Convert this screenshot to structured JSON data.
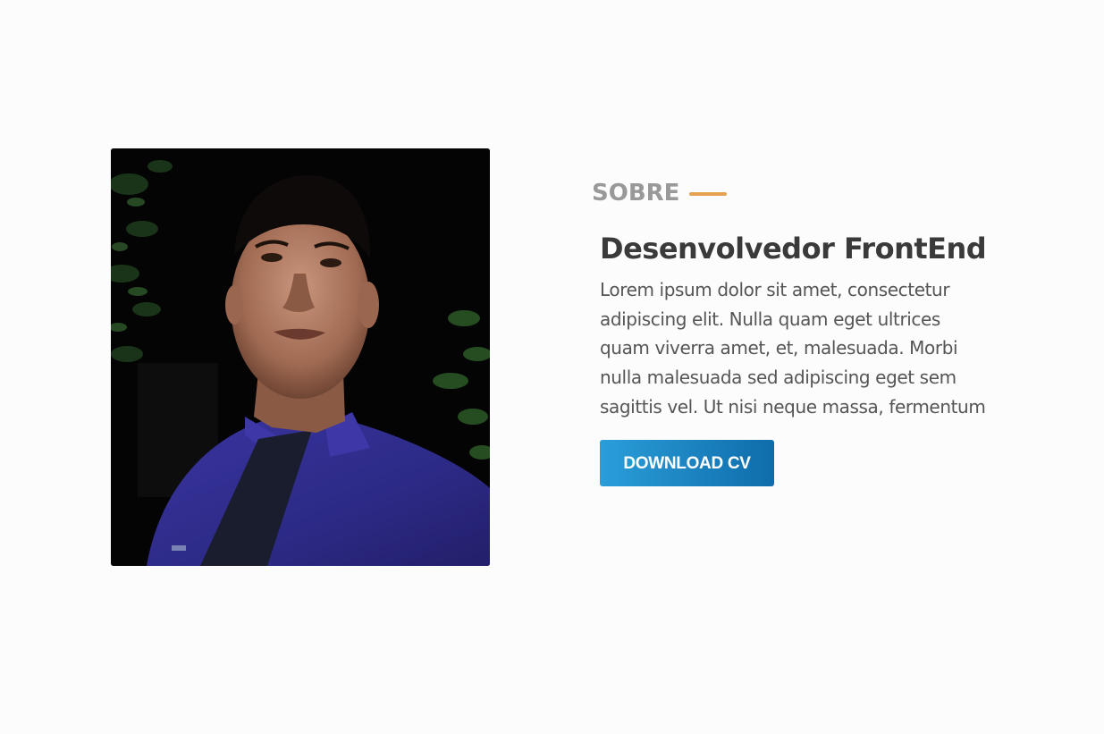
{
  "profile": {
    "photo_icon": "profile-photo"
  },
  "about": {
    "section_label": "SOBRE",
    "accent_color": "#e7a153",
    "title": "Desenvolvedor FrontEnd",
    "description": "Lorem ipsum dolor sit amet, consectetur adipiscing elit. Nulla quam eget ultrices quam viverra amet, et, malesuada. Morbi nulla malesuada sed adipiscing eget sem sagittis vel. Ut nisi neque massa, fermentum",
    "button_label": "DOWNLOAD CV",
    "button_colors": [
      "#2a9ed9",
      "#0f6cab"
    ]
  }
}
